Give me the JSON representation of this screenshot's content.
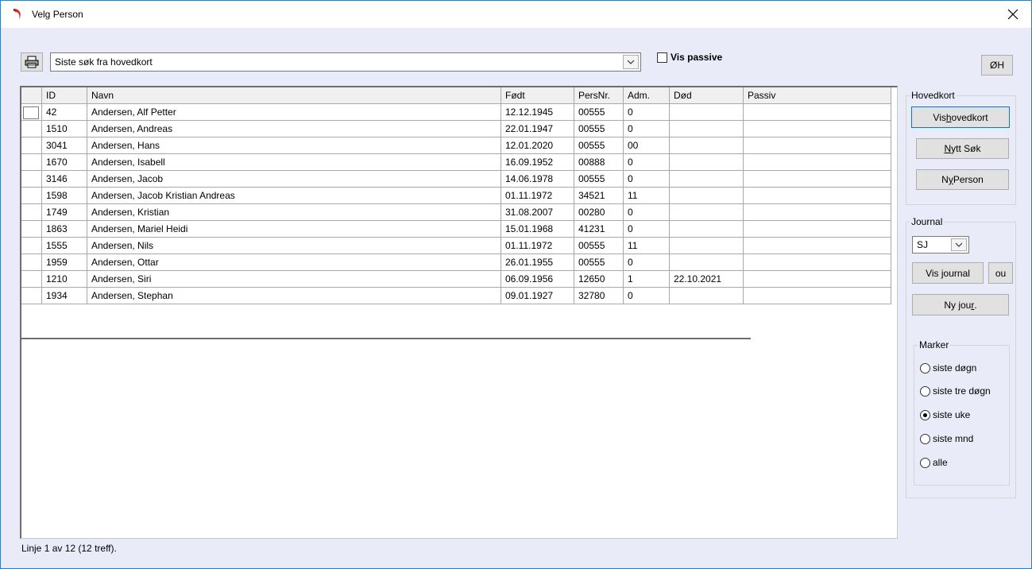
{
  "window": {
    "title": "Velg Person"
  },
  "toolbar": {
    "search_value": "Siste søk fra hovedkort",
    "vis_passive_label": "Vis passive",
    "oh_label": "ØH"
  },
  "grid": {
    "columns": [
      "ID",
      "Navn",
      "Født",
      "PersNr.",
      "Adm.",
      "Død",
      "Passiv"
    ],
    "rows": [
      {
        "id": "42",
        "navn": "Andersen, Alf Petter",
        "fodt": "12.12.1945",
        "persnr": "00555",
        "adm": "0",
        "dod": "",
        "passiv": ""
      },
      {
        "id": "1510",
        "navn": "Andersen, Andreas",
        "fodt": "22.01.1947",
        "persnr": "00555",
        "adm": "0",
        "dod": "",
        "passiv": ""
      },
      {
        "id": "3041",
        "navn": "Andersen, Hans",
        "fodt": "12.01.2020",
        "persnr": "00555",
        "adm": "00",
        "dod": "",
        "passiv": ""
      },
      {
        "id": "1670",
        "navn": "Andersen, Isabell",
        "fodt": "16.09.1952",
        "persnr": "00888",
        "adm": "0",
        "dod": "",
        "passiv": ""
      },
      {
        "id": "3146",
        "navn": "Andersen, Jacob",
        "fodt": "14.06.1978",
        "persnr": "00555",
        "adm": "0",
        "dod": "",
        "passiv": ""
      },
      {
        "id": "1598",
        "navn": "Andersen, Jacob Kristian Andreas",
        "fodt": "01.11.1972",
        "persnr": "34521",
        "adm": "11",
        "dod": "",
        "passiv": ""
      },
      {
        "id": "1749",
        "navn": "Andersen, Kristian",
        "fodt": "31.08.2007",
        "persnr": "00280",
        "adm": "0",
        "dod": "",
        "passiv": ""
      },
      {
        "id": "1863",
        "navn": "Andersen, Mariel Heidi",
        "fodt": "15.01.1968",
        "persnr": "41231",
        "adm": "0",
        "dod": "",
        "passiv": ""
      },
      {
        "id": "1555",
        "navn": "Andersen, Nils",
        "fodt": "01.11.1972",
        "persnr": "00555",
        "adm": "11",
        "dod": "",
        "passiv": ""
      },
      {
        "id": "1959",
        "navn": "Andersen, Ottar",
        "fodt": "26.01.1955",
        "persnr": "00555",
        "adm": "0",
        "dod": "",
        "passiv": ""
      },
      {
        "id": "1210",
        "navn": "Andersen, Siri",
        "fodt": "06.09.1956",
        "persnr": "12650",
        "adm": "1",
        "dod": "22.10.2021",
        "passiv": ""
      },
      {
        "id": "1934",
        "navn": "Andersen, Stephan",
        "fodt": "09.01.1927",
        "persnr": "32780",
        "adm": "0",
        "dod": "",
        "passiv": ""
      }
    ]
  },
  "status": {
    "text": "Linje 1 av 12 (12 treff)."
  },
  "hovedkort": {
    "title": "Hovedkort",
    "vis_hovedkort_pre": "Vis ",
    "vis_hovedkort_u": "h",
    "vis_hovedkort_post": "ovedkort",
    "nytt_sok_u": "N",
    "nytt_sok_post": "ytt Søk",
    "ny_person_pre": "N",
    "ny_person_u": "y",
    "ny_person_post": " Person"
  },
  "journal": {
    "title": "Journal",
    "selected": "SJ",
    "vis_journal_label": "Vis journal",
    "ou_label": "ou",
    "ny_jour_pre": "Ny jou",
    "ny_jour_u": "r",
    "ny_jour_post": "."
  },
  "marker": {
    "title": "Marker",
    "options": [
      "siste døgn",
      "siste tre døgn",
      "siste uke",
      "siste mnd",
      "alle"
    ],
    "selected_index": 2
  },
  "colors": {
    "accent": "#0078d7",
    "background": "#e9ecf8",
    "grid_border": "#6d6d6d"
  },
  "icons": {
    "app": "app-logo-icon",
    "print": "printer-icon",
    "close": "close-icon",
    "dropdown": "chevron-down-icon"
  }
}
